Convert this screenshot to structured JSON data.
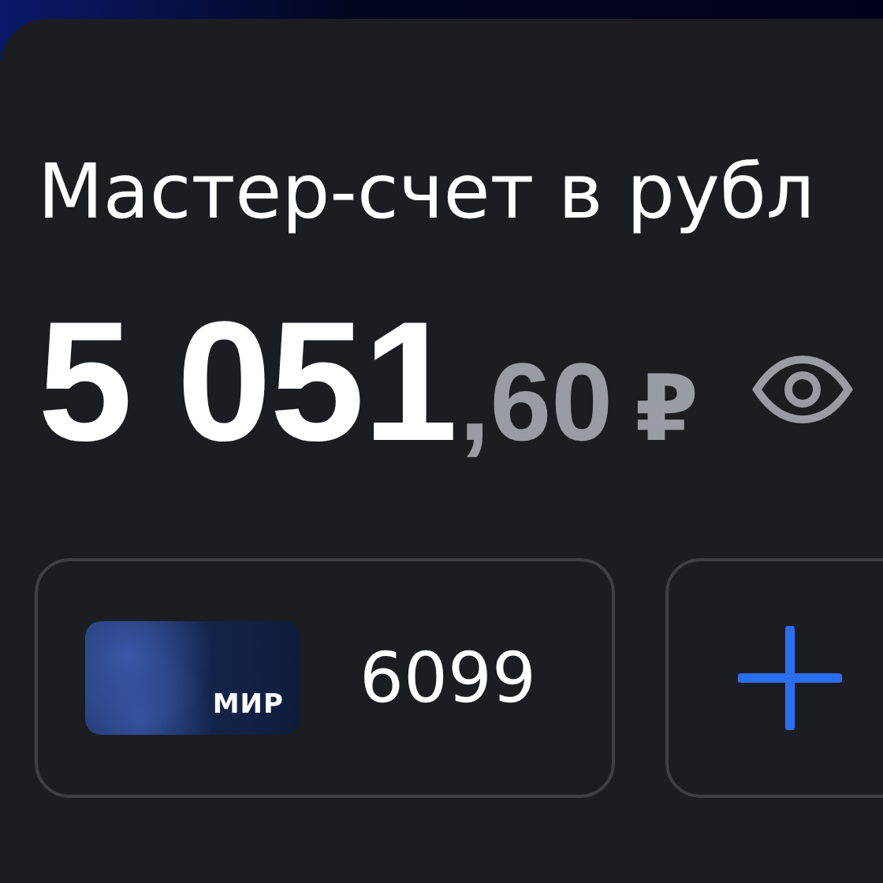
{
  "account": {
    "title": "Мастер-счет в рубл",
    "balance_whole": "5 051",
    "balance_fraction": ",60",
    "currency": "₽"
  },
  "cards": [
    {
      "kind": "card",
      "brand": "МИР",
      "number": "6099"
    },
    {
      "kind": "add"
    }
  ]
}
